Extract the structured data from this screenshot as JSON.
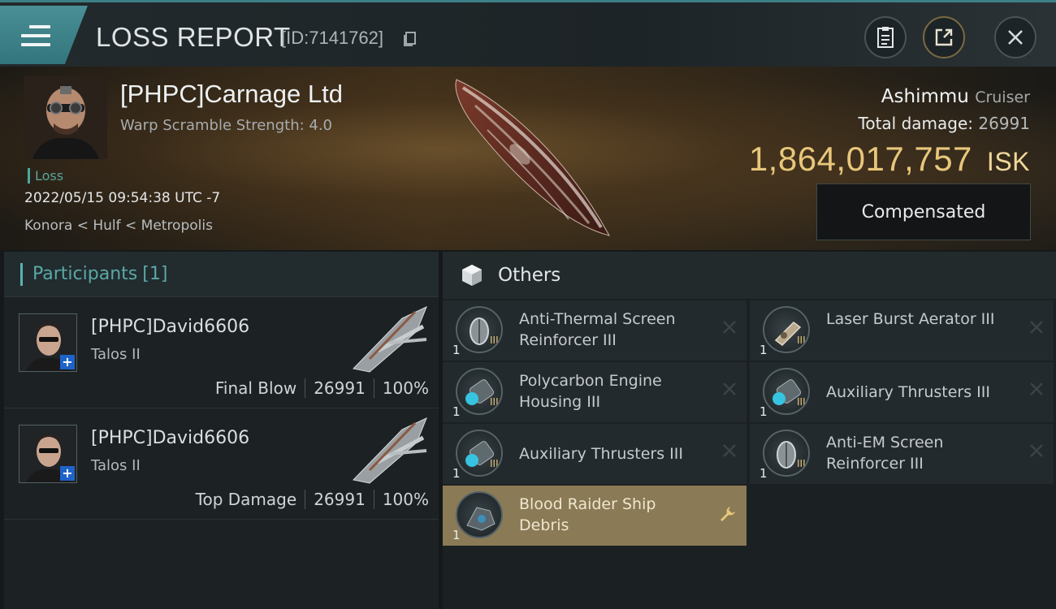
{
  "header": {
    "title": "LOSS REPORT",
    "report_id": "[ID:7141762]",
    "icons": [
      "menu-icon",
      "copy-icon",
      "clipboard-icon",
      "share-icon",
      "close-icon"
    ]
  },
  "victim": {
    "name": "[PHPC]Carnage Ltd",
    "scramble": "Warp Scramble Strength: 4.0",
    "tag": "Loss",
    "datetime": "2022/05/15 09:54:38 UTC -7",
    "location": "Konora < Hulf < Metropolis",
    "ship_name": "Ashimmu",
    "ship_class": "Cruiser",
    "total_damage_label": "Total damage:",
    "total_damage": "26991",
    "isk_value": "1,864,017,757",
    "isk_unit": "ISK",
    "compensated_label": "Compensated"
  },
  "participants": {
    "title": "Participants",
    "count": "[1]",
    "rows": [
      {
        "name": "[PHPC]David6606",
        "ship": "Talos II",
        "role": "Final Blow",
        "damage": "26991",
        "percent": "100%"
      },
      {
        "name": "[PHPC]David6606",
        "ship": "Talos II",
        "role": "Top Damage",
        "damage": "26991",
        "percent": "100%"
      }
    ]
  },
  "others": {
    "title": "Others",
    "items": [
      {
        "name": "Anti-Thermal Screen Reinforcer III",
        "qty": "1",
        "action": "destroyed"
      },
      {
        "name": "Laser Burst Aerator III",
        "qty": "1",
        "action": "destroyed"
      },
      {
        "name": "Polycarbon Engine Housing III",
        "qty": "1",
        "action": "destroyed"
      },
      {
        "name": "Auxiliary Thrusters III",
        "qty": "1",
        "action": "destroyed"
      },
      {
        "name": "Auxiliary Thrusters III",
        "qty": "1",
        "action": "destroyed"
      },
      {
        "name": "Anti-EM Screen Reinforcer III",
        "qty": "1",
        "action": "destroyed"
      },
      {
        "name": "Blood Raider Ship Debris",
        "qty": "1",
        "action": "salvage"
      }
    ]
  },
  "colors": {
    "accent_teal": "#4aa99e",
    "isk_gold": "#e8c77b",
    "highlight_item": "#8a7a55"
  }
}
